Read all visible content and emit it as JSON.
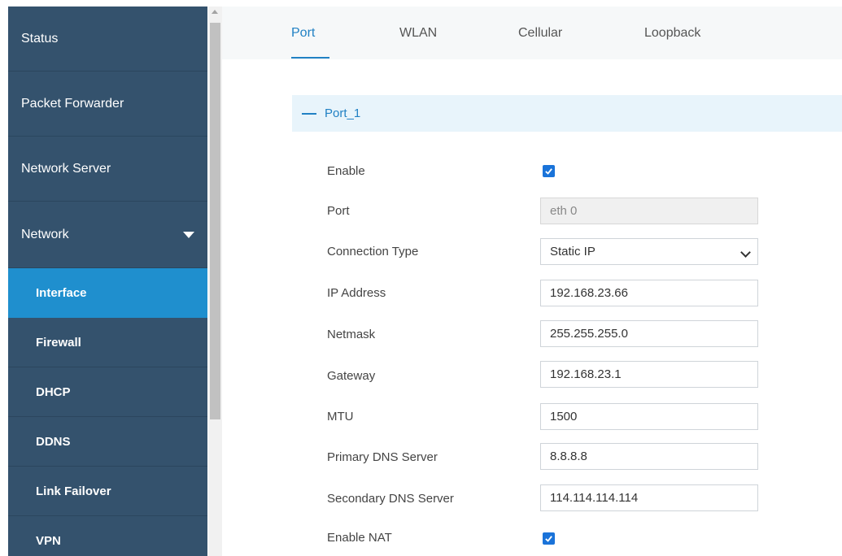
{
  "sidebar": {
    "items": [
      {
        "label": "Status"
      },
      {
        "label": "Packet Forwarder"
      },
      {
        "label": "Network Server"
      },
      {
        "label": "Network"
      },
      {
        "label": "Interface"
      },
      {
        "label": "Firewall"
      },
      {
        "label": "DHCP"
      },
      {
        "label": "DDNS"
      },
      {
        "label": "Link Failover"
      },
      {
        "label": "VPN"
      }
    ]
  },
  "tabs": [
    {
      "label": "Port"
    },
    {
      "label": "WLAN"
    },
    {
      "label": "Cellular"
    },
    {
      "label": "Loopback"
    }
  ],
  "section": {
    "title": "Port_1"
  },
  "form": {
    "enable": {
      "label": "Enable",
      "checked": true
    },
    "port": {
      "label": "Port",
      "value": "eth 0"
    },
    "connection_type": {
      "label": "Connection Type",
      "value": "Static IP"
    },
    "ip_address": {
      "label": "IP Address",
      "value": "192.168.23.66"
    },
    "netmask": {
      "label": "Netmask",
      "value": "255.255.255.0"
    },
    "gateway": {
      "label": "Gateway",
      "value": "192.168.23.1"
    },
    "mtu": {
      "label": "MTU",
      "value": "1500"
    },
    "primary_dns": {
      "label": "Primary DNS Server",
      "value": "8.8.8.8"
    },
    "secondary_dns": {
      "label": "Secondary DNS Server",
      "value": "114.114.114.114"
    },
    "enable_nat": {
      "label": "Enable NAT",
      "checked": true
    }
  },
  "colors": {
    "sidebar_bg": "#34526d",
    "sidebar_active": "#1f8fce",
    "accent": "#2181c4",
    "checkbox": "#1a73d9"
  }
}
